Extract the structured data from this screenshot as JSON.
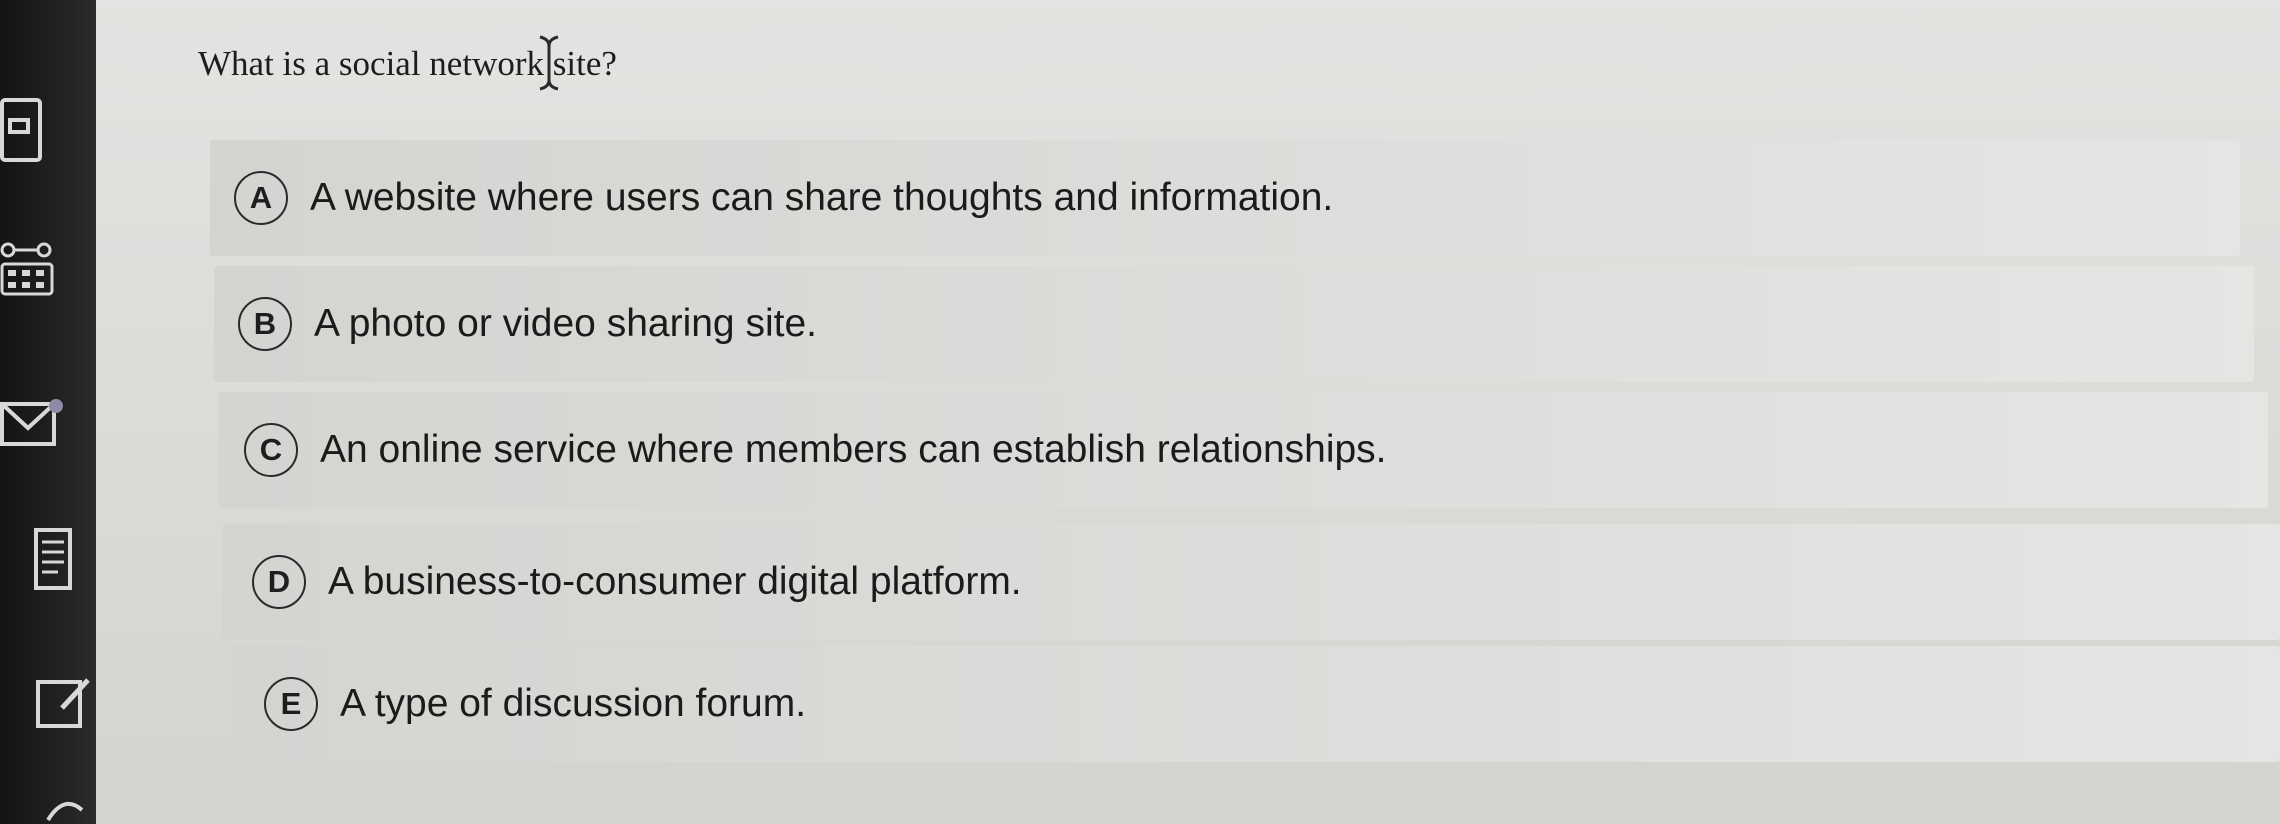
{
  "question": {
    "text": "What is a social network site?"
  },
  "options": [
    {
      "letter": "A",
      "text": "A website where users can share thoughts and information."
    },
    {
      "letter": "B",
      "text": "A photo or video sharing site."
    },
    {
      "letter": "C",
      "text": "An online service where members can establish relationships."
    },
    {
      "letter": "D",
      "text": "A business-to-consumer digital platform."
    },
    {
      "letter": "E",
      "text": "A type of discussion forum."
    }
  ],
  "sidebar": {
    "icons": [
      "calculator-icon",
      "grid-icon",
      "mail-icon",
      "document-icon",
      "edit-icon"
    ]
  }
}
